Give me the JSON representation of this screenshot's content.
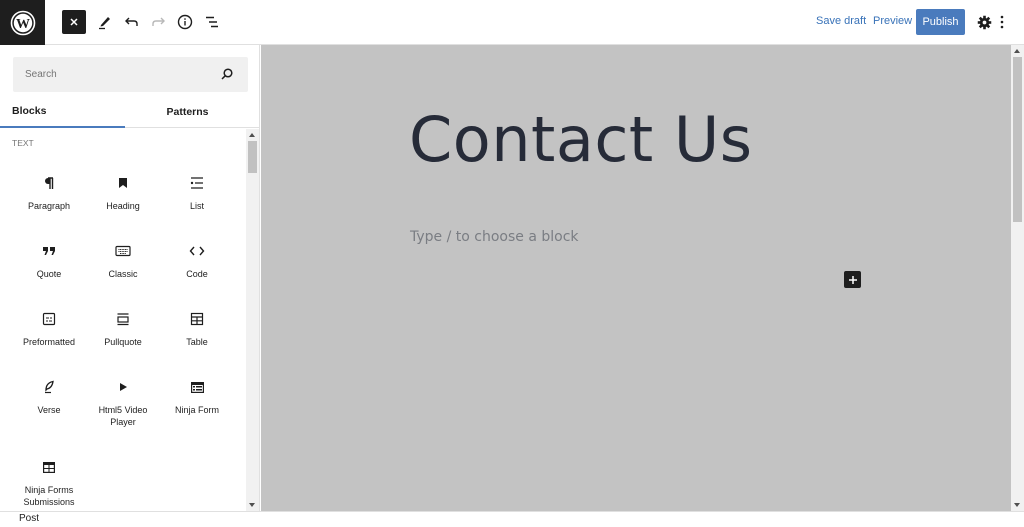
{
  "topbar": {
    "logo": "wordpress-logo",
    "tools": [
      {
        "name": "close-inserter",
        "icon": "close-icon"
      },
      {
        "name": "tools",
        "icon": "pencil-icon"
      },
      {
        "name": "undo",
        "icon": "undo-icon"
      },
      {
        "name": "redo",
        "icon": "redo-icon"
      },
      {
        "name": "details",
        "icon": "info-icon"
      },
      {
        "name": "list-view",
        "icon": "list-view-icon"
      }
    ],
    "save_draft_label": "Save draft",
    "preview_label": "Preview",
    "publish_label": "Publish",
    "settings_icon": "gear-icon",
    "options_icon": "more-vertical-icon"
  },
  "sidebar": {
    "search_placeholder": "Search",
    "tabs": [
      {
        "label": "Blocks",
        "active": true
      },
      {
        "label": "Patterns",
        "active": false
      }
    ],
    "category": "TEXT",
    "blocks": [
      {
        "label": "Paragraph",
        "icon": "paragraph-icon"
      },
      {
        "label": "Heading",
        "icon": "heading-icon"
      },
      {
        "label": "List",
        "icon": "list-icon"
      },
      {
        "label": "Quote",
        "icon": "quote-icon"
      },
      {
        "label": "Classic",
        "icon": "keyboard-icon"
      },
      {
        "label": "Code",
        "icon": "code-icon"
      },
      {
        "label": "Preformatted",
        "icon": "preformatted-icon"
      },
      {
        "label": "Pullquote",
        "icon": "pullquote-icon"
      },
      {
        "label": "Table",
        "icon": "table-icon"
      },
      {
        "label": "Verse",
        "icon": "verse-icon"
      },
      {
        "label": "Html5 Video Player",
        "icon": "play-icon"
      },
      {
        "label": "Ninja Form",
        "icon": "ninja-form-icon"
      },
      {
        "label": "Ninja Forms Submissions",
        "icon": "table-icon"
      }
    ]
  },
  "canvas": {
    "title": "Contact Us",
    "block_placeholder": "Type / to choose a block"
  },
  "footer": {
    "breadcrumb": "Post"
  },
  "colors": {
    "accent": "#4a7bbd",
    "link": "#3872b8",
    "dark": "#1e1e1e",
    "canvas_bg": "#c3c3c3"
  }
}
